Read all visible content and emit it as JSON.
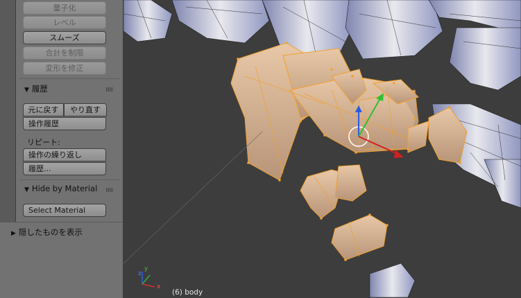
{
  "tool_panel": {
    "top_buttons": [
      "量子化",
      "レベル",
      "スムーズ",
      "合計を制限",
      "変形を修正"
    ],
    "history": {
      "title": "履歴",
      "undo": "元に戻す",
      "redo": "やり直す",
      "op_history": "操作履歴",
      "repeat_label": "リピート:",
      "repeat_last": "操作の繰り返し",
      "repeat_history": "履歴..."
    },
    "hide_by_material": {
      "title": "Hide by Material",
      "select": "Select Material"
    }
  },
  "lower_panel": {
    "title": "隠したものを表示"
  },
  "viewport": {
    "object_info": "(6) body",
    "axis_labels": {
      "x": "x",
      "y": "y",
      "z": "z"
    }
  },
  "colors": {
    "panel_bg": "#727272",
    "viewport_bg": "#3d3d3d",
    "selection": "#f0a030",
    "mesh_grey": "#c8ccd8"
  }
}
